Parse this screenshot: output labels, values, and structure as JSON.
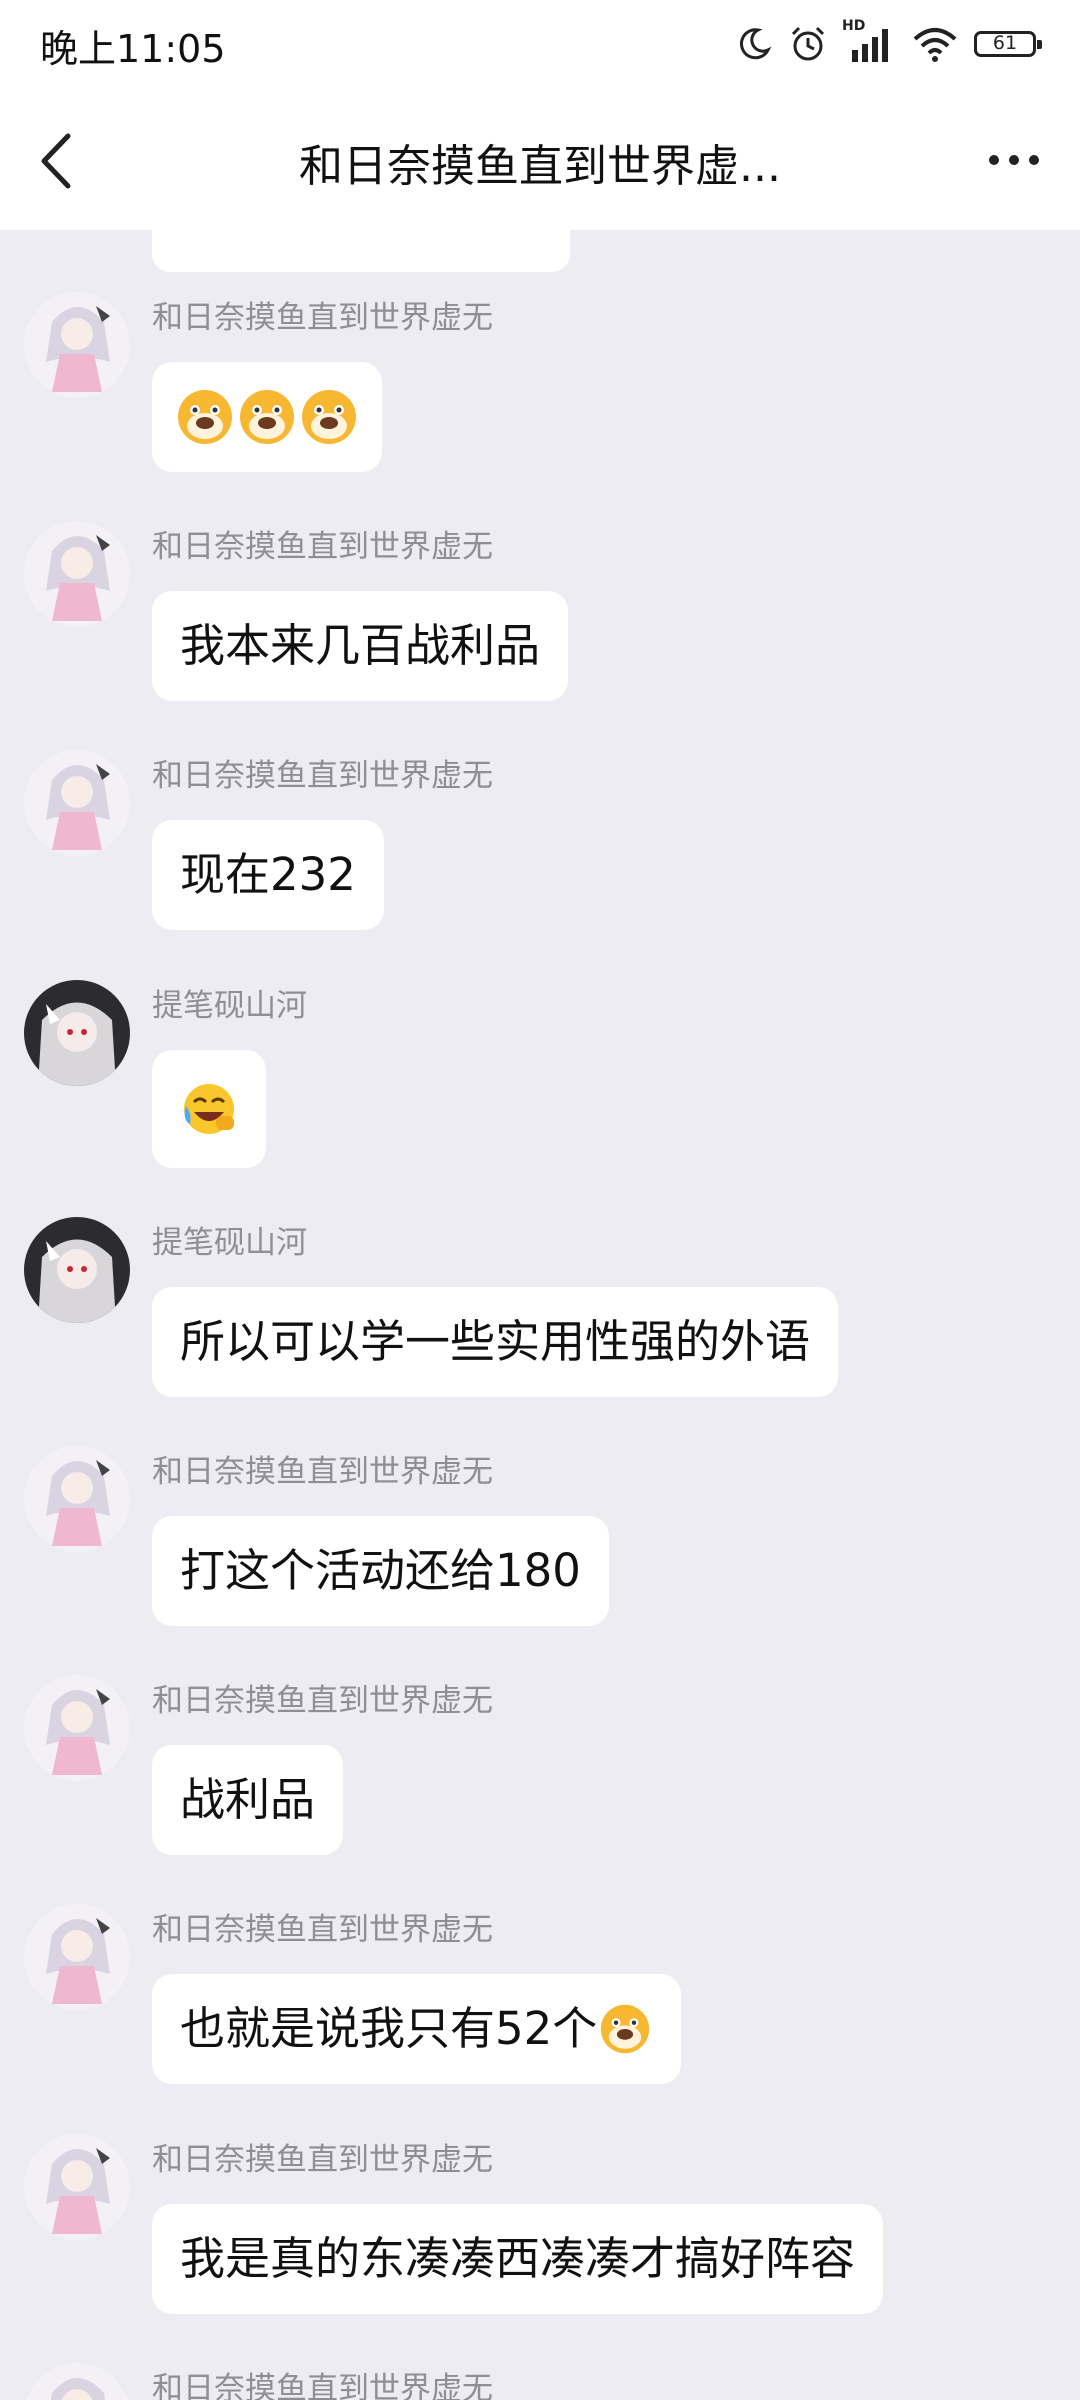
{
  "status": {
    "time": "晚上11:05",
    "battery": "61",
    "hd": "HD"
  },
  "header": {
    "title": "和日奈摸鱼直到世界虚..."
  },
  "messages": [
    {
      "sender": "和日奈摸鱼直到世界虚无",
      "text": "",
      "emoji": "dog-face-emoji x3"
    },
    {
      "sender": "和日奈摸鱼直到世界虚无",
      "text": "我本来几百战利品"
    },
    {
      "sender": "和日奈摸鱼直到世界虚无",
      "text": "现在232"
    },
    {
      "sender": "提笔砚山河",
      "text": "",
      "emoji": "laughing-crying-emoji"
    },
    {
      "sender": "提笔砚山河",
      "text": "所以可以学一些实用性强的外语"
    },
    {
      "sender": "和日奈摸鱼直到世界虚无",
      "text": "打这个活动还给180"
    },
    {
      "sender": "和日奈摸鱼直到世界虚无",
      "text": "战利品"
    },
    {
      "sender": "和日奈摸鱼直到世界虚无",
      "text": "也就是说我只有52个",
      "emoji": "dog-face-emoji"
    },
    {
      "sender": "和日奈摸鱼直到世界虚无",
      "text": "我是真的东凑凑西凑凑才搞好阵容"
    },
    {
      "sender": "和日奈摸鱼直到世界虚无",
      "text": ""
    }
  ],
  "colors": {
    "background": "#ececf2",
    "bubble": "#ffffff",
    "sender": "#8e8e96"
  }
}
